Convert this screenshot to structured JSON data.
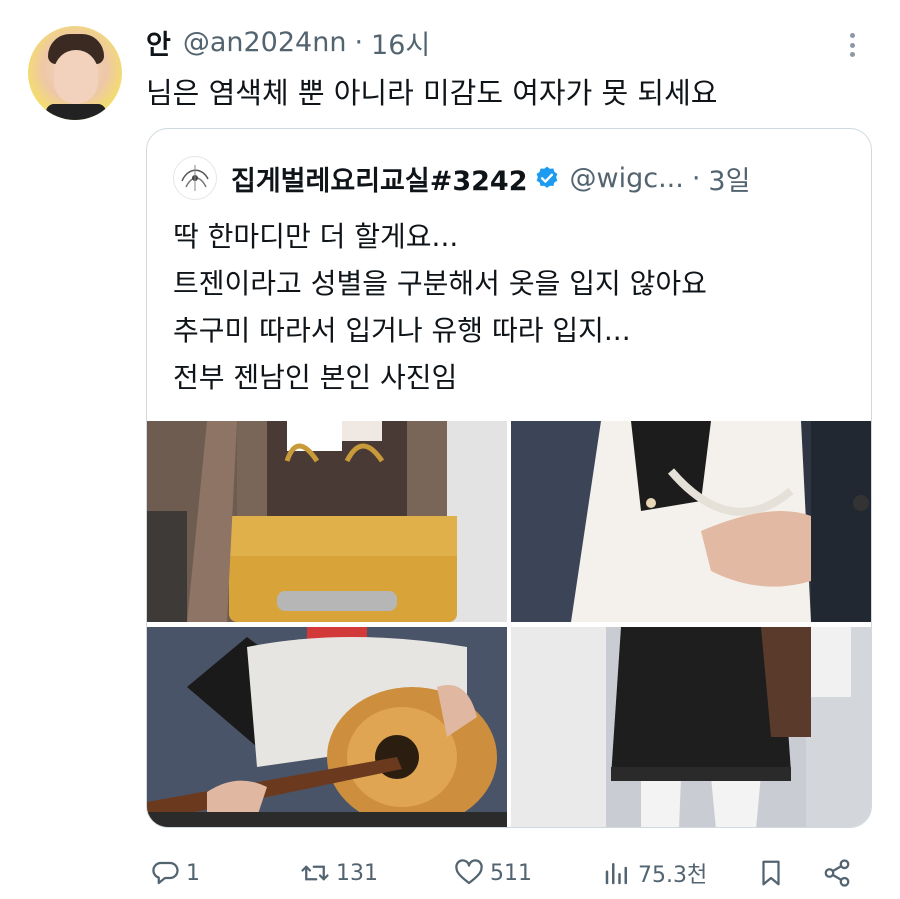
{
  "tweet": {
    "author_name": "안",
    "handle": "@an2024nn",
    "separator": "·",
    "time": "16시",
    "text": "님은 염색체 뿐 아니라 미감도 여자가 못 되세요"
  },
  "quoted": {
    "author_name": "집게벌레요리교실#3242",
    "handle": "@wigc...",
    "separator": "·",
    "time": "3일",
    "lines": [
      "딱 한마디만 더 할게요...",
      "트젠이라고 성별을 구분해서 옷을 입지 않아요",
      "추구미 따라서 입거나 유행 따라 입지...",
      "전부 젠남인 본인 사진임"
    ]
  },
  "actions": {
    "reply_count": "1",
    "retweet_count": "131",
    "like_count": "511",
    "views_count": "75.3천"
  },
  "icons": {
    "more": "more-vertical-icon",
    "reply": "reply-icon",
    "retweet": "retweet-icon",
    "like": "heart-icon",
    "views": "views-chart-icon",
    "bookmark": "bookmark-icon",
    "share": "share-icon",
    "verified": "verified-badge-icon"
  },
  "colors": {
    "text_primary": "#0f1419",
    "text_secondary": "#536471",
    "verified_blue": "#1d9bf0",
    "border": "#cfd9de"
  }
}
